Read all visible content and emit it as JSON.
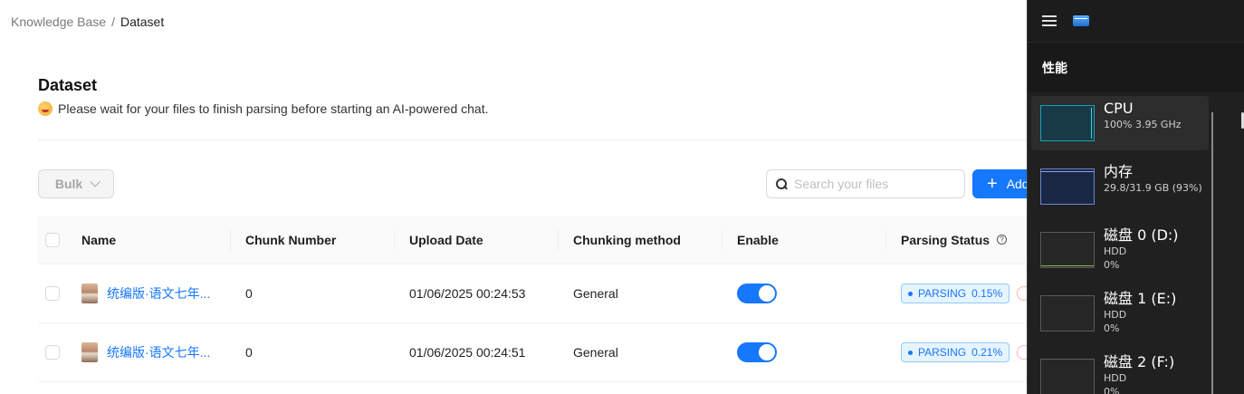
{
  "breadcrumb": {
    "root": "Knowledge Base",
    "separator": "/",
    "current": "Dataset"
  },
  "header": {
    "title": "Dataset",
    "notice": "Please wait for your files to finish parsing before starting an AI-powered chat."
  },
  "toolbar": {
    "bulk_label": "Bulk",
    "search_placeholder": "Search your files",
    "add_label": "Add"
  },
  "table": {
    "columns": [
      "Name",
      "Chunk Number",
      "Upload Date",
      "Chunking method",
      "Enable",
      "Parsing Status"
    ],
    "rows": [
      {
        "name": "统编版·语文七年...",
        "chunks": "0",
        "date": "01/06/2025 00:24:53",
        "method": "General",
        "enabled": true,
        "status": "PARSING",
        "progress": "0.15%"
      },
      {
        "name": "统编版·语文七年...",
        "chunks": "0",
        "date": "01/06/2025 00:24:51",
        "method": "General",
        "enabled": true,
        "status": "PARSING",
        "progress": "0.21%"
      }
    ]
  },
  "colors": {
    "accent": "#1677ff",
    "tm_background": "#202020"
  },
  "task_manager": {
    "section": "性能",
    "items": [
      {
        "name": "CPU",
        "line1": "100% 3.95 GHz",
        "line2": "",
        "active": true
      },
      {
        "name": "内存",
        "line1": "29.8/31.9 GB (93%)",
        "line2": ""
      },
      {
        "name": "磁盘 0 (D:)",
        "line1": "HDD",
        "line2": "0%"
      },
      {
        "name": "磁盘 1 (E:)",
        "line1": "HDD",
        "line2": "0%"
      },
      {
        "name": "磁盘 2 (F:)",
        "line1": "HDD",
        "line2": "0%"
      }
    ]
  }
}
